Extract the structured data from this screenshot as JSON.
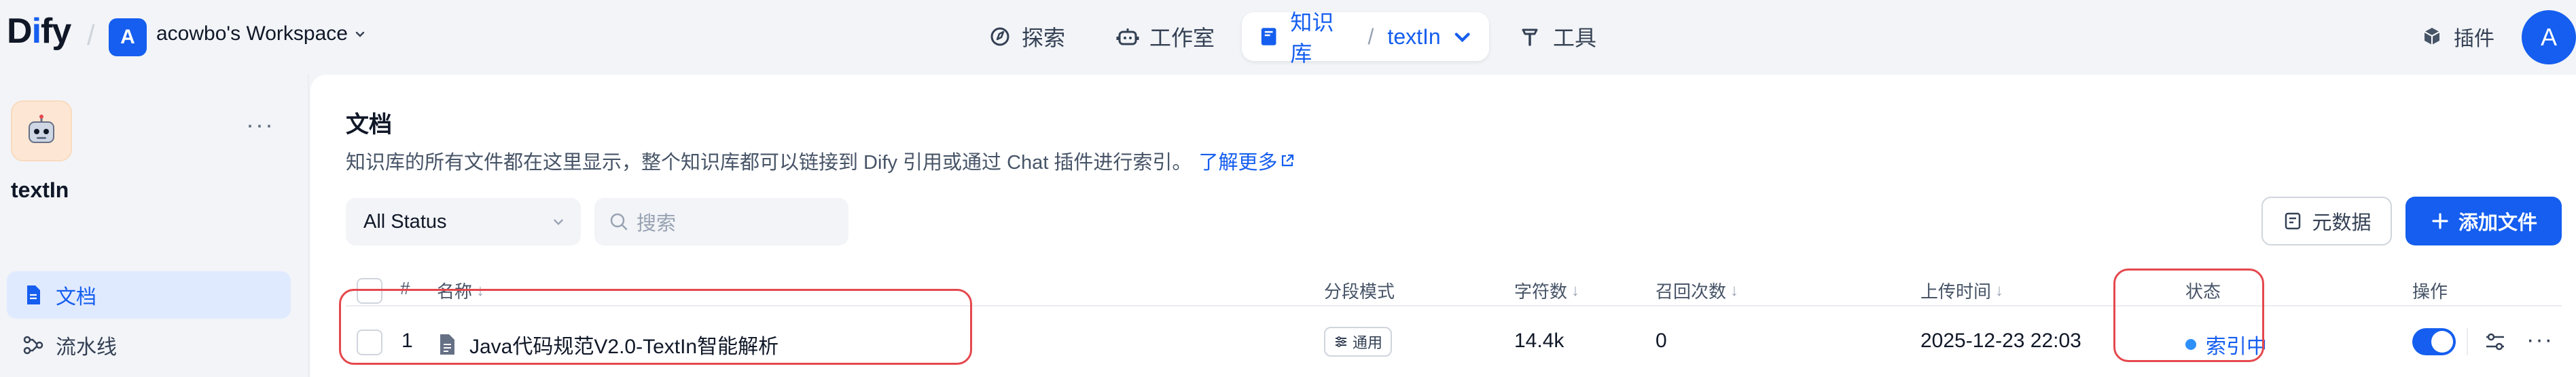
{
  "brand": {
    "logo_text_pre": "D",
    "logo_text_i": "i",
    "logo_text_post": "fy"
  },
  "workspace": {
    "avatar_letter": "A",
    "name": "acowbo's Workspace"
  },
  "nav": {
    "explore": "探索",
    "studio": "工作室",
    "knowledge": "知识库",
    "current_dataset": "textIn",
    "tools": "工具",
    "plugins": "插件"
  },
  "user": {
    "avatar_letter": "A"
  },
  "sidebar": {
    "dataset_name": "textIn",
    "items": [
      {
        "label": "文档",
        "active": true
      },
      {
        "label": "流水线",
        "active": false
      }
    ]
  },
  "main": {
    "title": "文档",
    "description": "知识库的所有文件都在这里显示，整个知识库都可以链接到 Dify 引用或通过 Chat 插件进行索引。",
    "learn_more": "了解更多",
    "filter": {
      "status_value": "All Status",
      "search_placeholder": "搜索"
    },
    "buttons": {
      "metadata": "元数据",
      "add_file": "添加文件"
    }
  },
  "table": {
    "headers": {
      "index": "#",
      "name": "名称",
      "mode": "分段模式",
      "chars": "字符数",
      "hits": "召回次数",
      "upload_time": "上传时间",
      "status": "状态",
      "actions": "操作"
    },
    "rows": [
      {
        "index": "1",
        "name": "Java代码规范V2.0-TextIn智能解析",
        "mode": "通用",
        "chars": "14.4k",
        "hits": "0",
        "upload_time": "2025-12-23 22:03",
        "status": "索引中",
        "enabled": true
      }
    ]
  },
  "colors": {
    "accent": "#155eef",
    "annotation": "#e5484d",
    "status_dot": "#2e90fa"
  }
}
